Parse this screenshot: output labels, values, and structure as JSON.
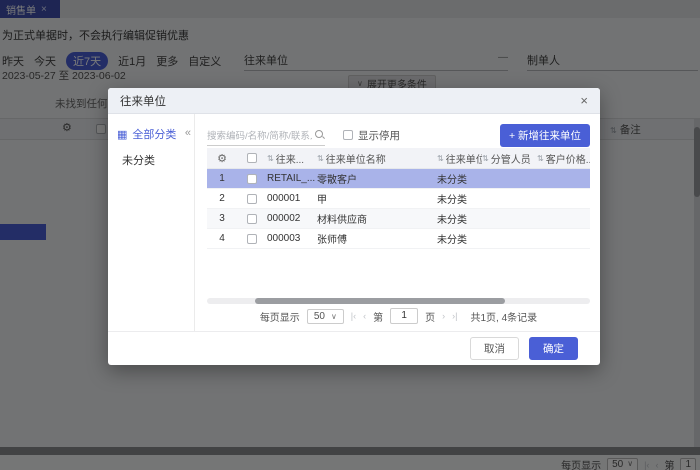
{
  "colors": {
    "primary": "#4a5fd6",
    "selected_row": "#a9b3e9"
  },
  "page": {
    "tab": {
      "label": "销售单"
    },
    "note": "为正式单据时，不会执行编辑促销优惠",
    "filters": {
      "quick": [
        "昨天",
        "今天",
        "近7天",
        "近1月",
        "更多",
        "自定义"
      ],
      "active": "近7天",
      "date_range": "2023-05-27 至 2023-06-02",
      "partner_label": "往来单位",
      "dash": "—",
      "maker_label": "制单人",
      "expand_button": "展开更多条件"
    },
    "background_table": {
      "remark_header": "备注",
      "empty_text": "未找到任何业务数据"
    },
    "bottom_pagination": {
      "per_page_label": "每页显示",
      "per_page": "50",
      "jump_prefix": "第",
      "page": "1"
    }
  },
  "modal": {
    "title": "往来单位",
    "sidebar": {
      "all_label": "全部分类",
      "items": [
        "未分类"
      ]
    },
    "toolbar": {
      "search_placeholder": "搜索编码/名称/简称/联系人/联系",
      "show_disabled_label": "显示停用",
      "add_button": "+ 新增往来单位"
    },
    "table": {
      "headers": [
        "往来...",
        "往来单位名称",
        "往来单位...",
        "分管人员",
        "客户价格..."
      ],
      "rows": [
        {
          "index": "1",
          "code": "RETAIL_...",
          "name": "零散客户",
          "category": "未分类"
        },
        {
          "index": "2",
          "code": "000001",
          "name": "甲",
          "category": "未分类"
        },
        {
          "index": "3",
          "code": "000002",
          "name": "材料供应商",
          "category": "未分类"
        },
        {
          "index": "4",
          "code": "000003",
          "name": "张师傅",
          "category": "未分类"
        }
      ]
    },
    "pagination": {
      "per_page_label": "每页显示",
      "per_page": "50",
      "jump_prefix": "第",
      "page": "1",
      "jump_suffix": "页",
      "total": "共1页, 4条记录"
    },
    "footer": {
      "cancel": "取消",
      "confirm": "确定"
    }
  }
}
